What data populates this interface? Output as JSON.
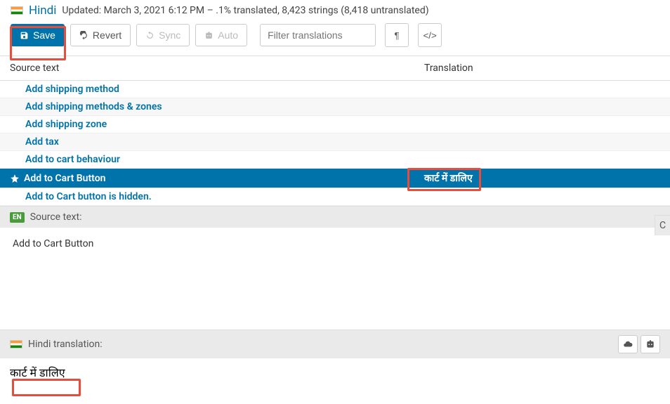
{
  "header": {
    "language": "Hindi",
    "updated": "Updated: March 3, 2021 6:12 PM – .1% translated, 8,423 strings (8,418 untranslated)"
  },
  "toolbar": {
    "save": "Save",
    "revert": "Revert",
    "sync": "Sync",
    "auto": "Auto",
    "filter_placeholder": "Filter translations"
  },
  "columns": {
    "source": "Source text",
    "translation": "Translation"
  },
  "rows": [
    {
      "source": "Add shipping method",
      "translation": "",
      "selected": false
    },
    {
      "source": "Add shipping methods & zones",
      "translation": "",
      "selected": false
    },
    {
      "source": "Add shipping zone",
      "translation": "",
      "selected": false
    },
    {
      "source": "Add tax",
      "translation": "",
      "selected": false
    },
    {
      "source": "Add to cart behaviour",
      "translation": "",
      "selected": false
    },
    {
      "source": "Add to Cart Button",
      "translation": "कार्ट में डालिए",
      "selected": true
    },
    {
      "source": "Add to Cart button is hidden.",
      "translation": "",
      "selected": false
    }
  ],
  "editor": {
    "source_badge": "EN",
    "source_label": "Source text:",
    "source_value": "Add to Cart Button",
    "context_label": "C",
    "trans_label": "Hindi translation:",
    "trans_value": "कार्ट में डालिए"
  }
}
